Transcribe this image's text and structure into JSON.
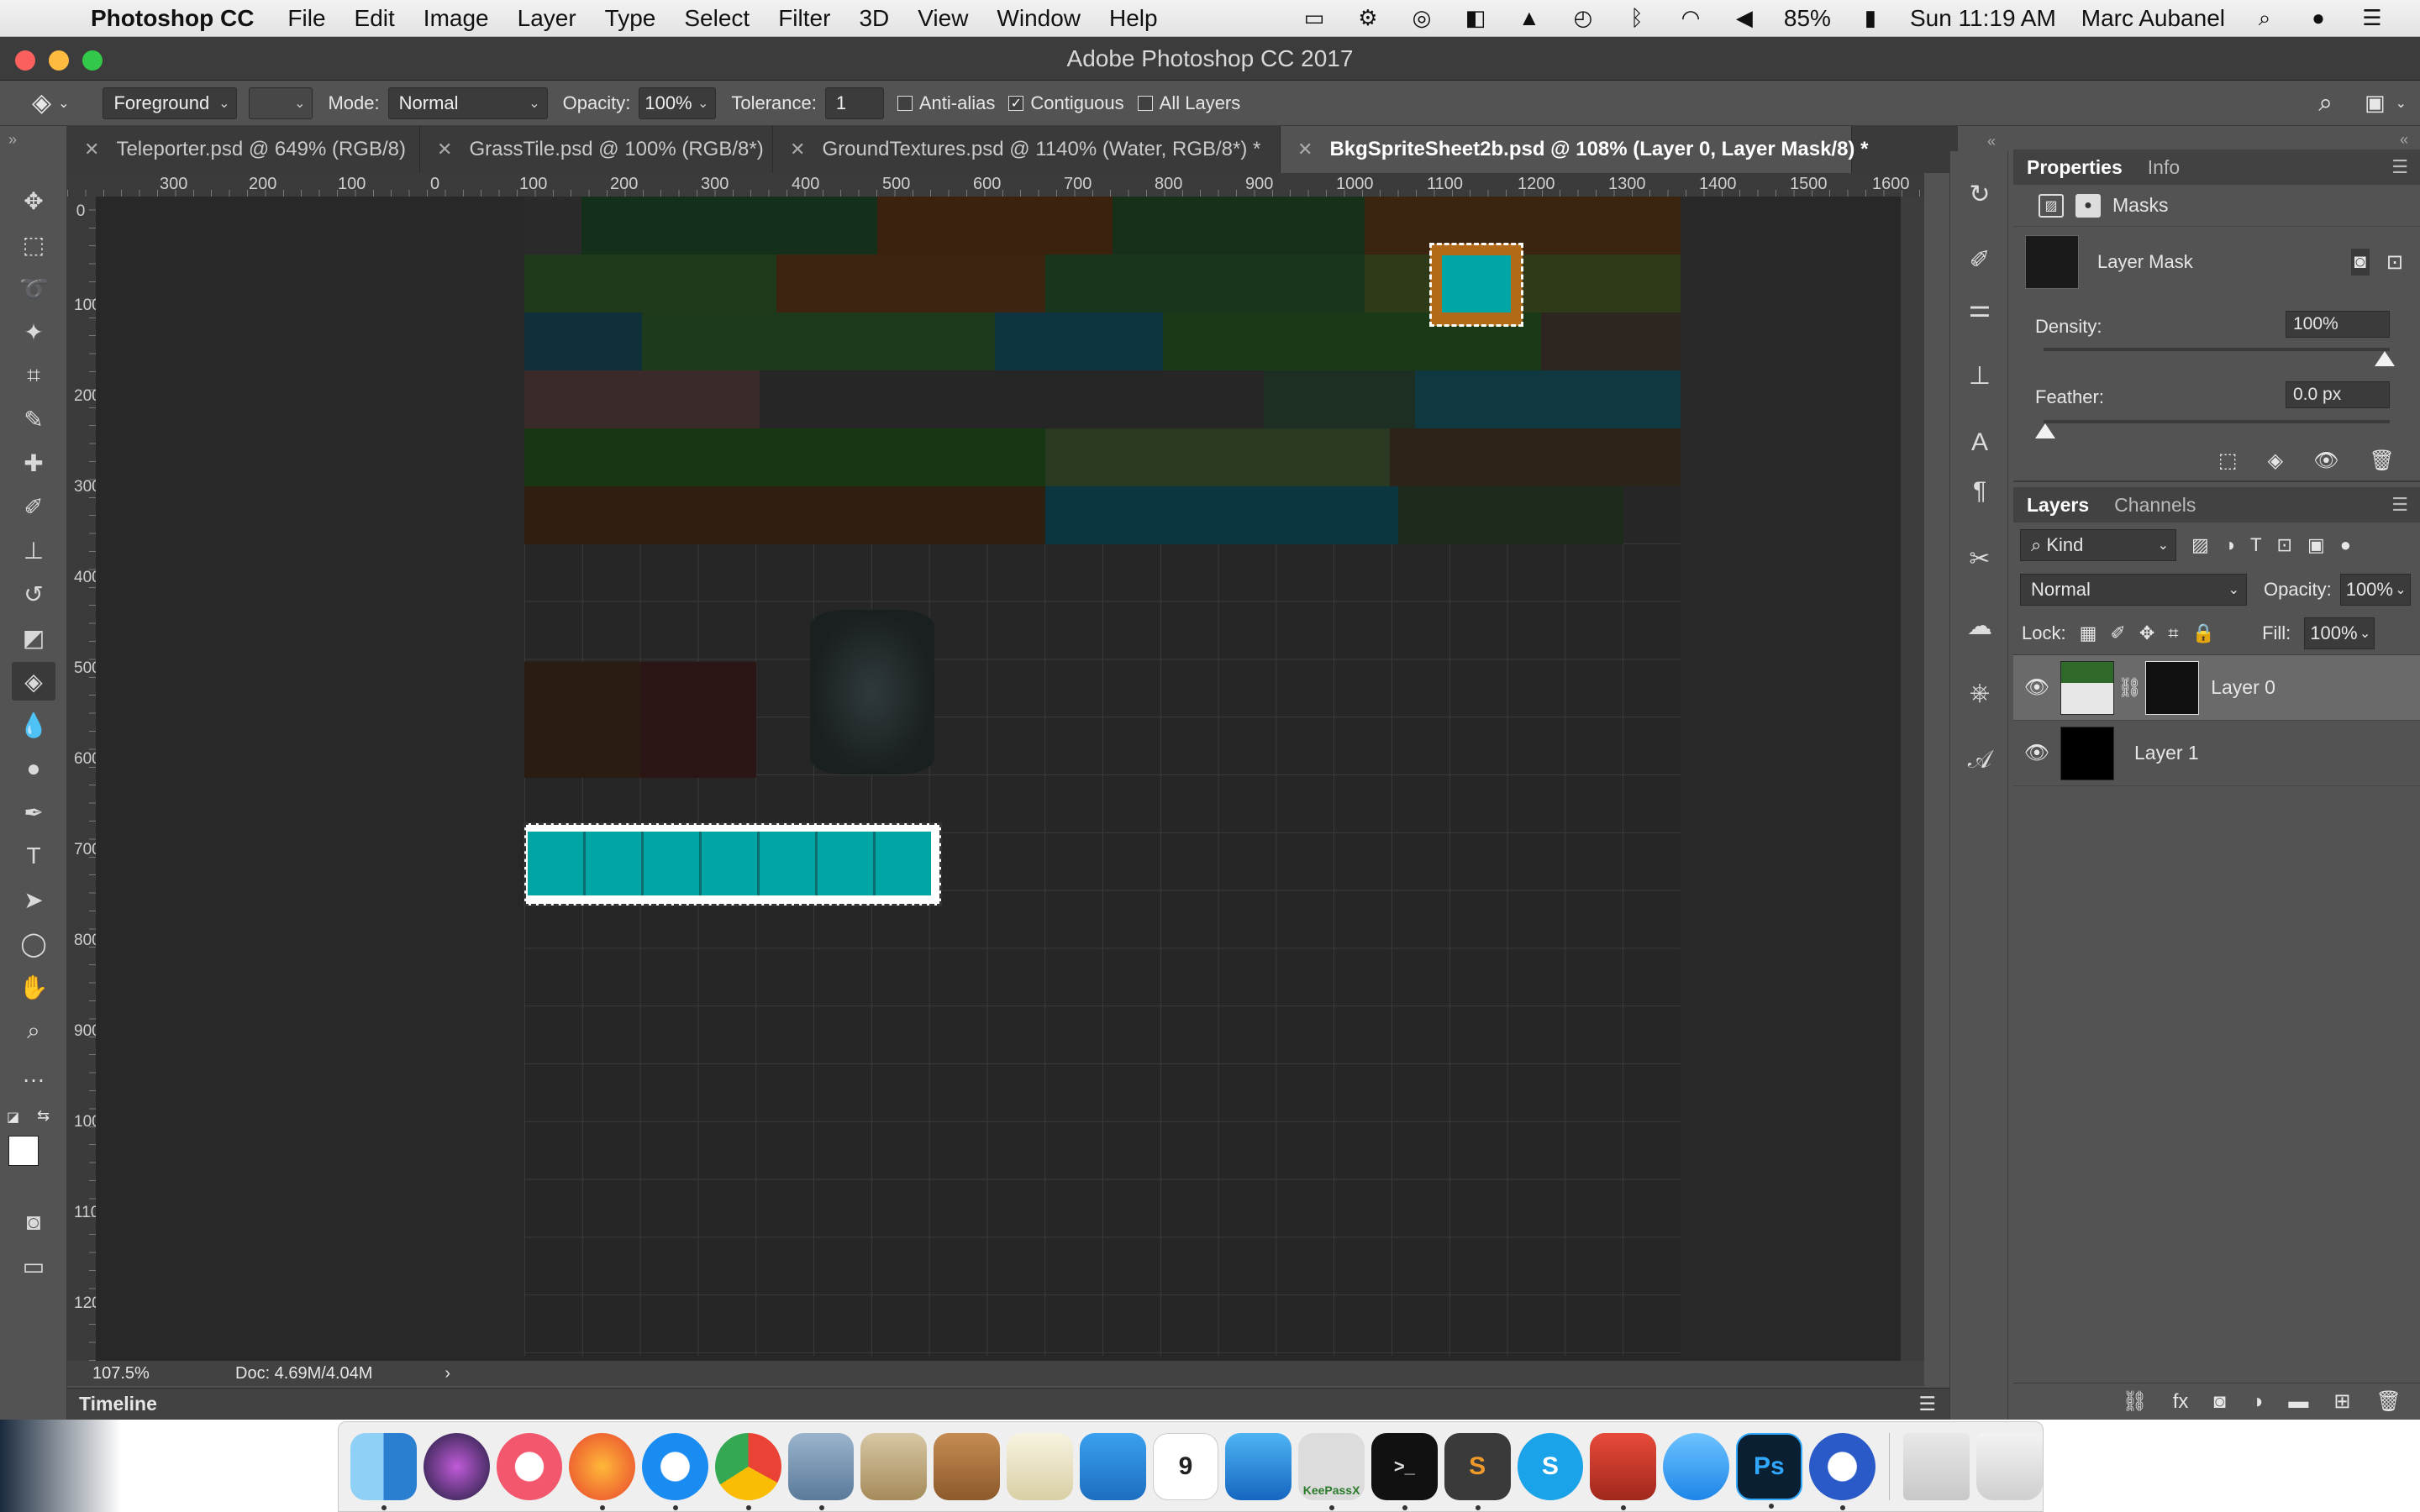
{
  "menubar": {
    "app_name": "Photoshop CC",
    "menus": [
      "File",
      "Edit",
      "Image",
      "Layer",
      "Type",
      "Select",
      "Filter",
      "3D",
      "View",
      "Window",
      "Help"
    ],
    "battery": "85%",
    "clock": "Sun 11:19 AM",
    "user": "Marc Aubanel"
  },
  "window": {
    "title": "Adobe Photoshop CC 2017"
  },
  "options": {
    "fill_source": "Foreground",
    "mode_label": "Mode:",
    "mode_value": "Normal",
    "opacity_label": "Opacity:",
    "opacity_value": "100%",
    "tolerance_label": "Tolerance:",
    "tolerance_value": "1",
    "anti_alias": "Anti-alias",
    "contiguous": "Contiguous",
    "all_layers": "All Layers"
  },
  "tabs": [
    {
      "label": "Teleporter.psd @ 649% (RGB/8)"
    },
    {
      "label": "GrassTile.psd @ 100% (RGB/8*)"
    },
    {
      "label": "GroundTextures.psd @ 1140% (Water, RGB/8*) *"
    },
    {
      "label": "BkgSpriteSheet2b.psd @ 108% (Layer 0, Layer Mask/8) *"
    }
  ],
  "ruler": {
    "top": [
      "300",
      "200",
      "100",
      "0",
      "100",
      "200",
      "300",
      "400",
      "500",
      "600",
      "700",
      "800",
      "900",
      "1000",
      "1100",
      "1200",
      "1300",
      "1400",
      "1500",
      "1600"
    ],
    "left": [
      "0",
      "100",
      "200",
      "300",
      "400",
      "500",
      "600",
      "700",
      "800",
      "900",
      "1000",
      "1100",
      "1200"
    ]
  },
  "properties": {
    "tab_properties": "Properties",
    "tab_info": "Info",
    "section": "Masks",
    "mask_name": "Layer Mask",
    "density_label": "Density:",
    "density_value": "100%",
    "feather_label": "Feather:",
    "feather_value": "0.0 px"
  },
  "layers": {
    "tab_layers": "Layers",
    "tab_channels": "Channels",
    "filter_kind": "Kind",
    "blend_mode": "Normal",
    "opacity_label": "Opacity:",
    "opacity_value": "100%",
    "lock_label": "Lock:",
    "fill_label": "Fill:",
    "fill_value": "100%",
    "items": [
      {
        "name": "Layer 0"
      },
      {
        "name": "Layer 1"
      }
    ]
  },
  "status": {
    "zoom": "107.5%",
    "doc": "Doc: 4.69M/4.04M"
  },
  "timeline": {
    "label": "Timeline"
  },
  "colors": {
    "selection_cyan": "#00a6a6",
    "panel_bg": "#535353",
    "canvas_bg": "#282828"
  },
  "dock": {
    "apps": [
      "Finder",
      "Siri",
      "iTunes",
      "Firefox",
      "Safari",
      "Chrome",
      "Preview",
      "Mail",
      "Contacts",
      "TextEdit",
      "Keynote",
      "Calendar",
      "Xcode",
      "KeePassX",
      "Terminal",
      "Sublime",
      "Skype",
      "Parallels",
      "Messages",
      "Photoshop",
      "Camtasia",
      "Downloads",
      "Trash"
    ],
    "calendar_day": "9",
    "keepass_label": "KeePassX",
    "photoshop_label": "Ps"
  }
}
